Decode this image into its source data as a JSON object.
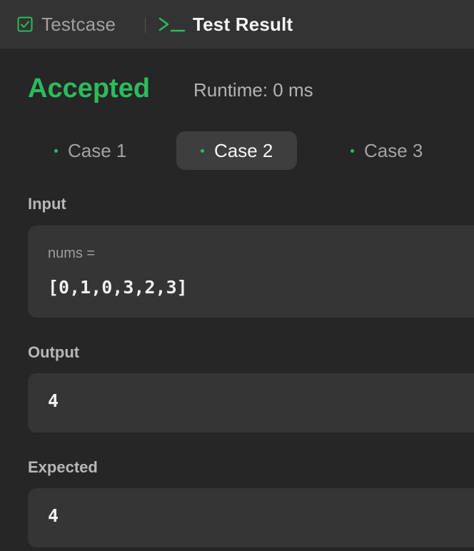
{
  "tabs": {
    "testcase_label": "Testcase",
    "result_label": "Test Result"
  },
  "result": {
    "status": "Accepted",
    "runtime": "Runtime: 0 ms"
  },
  "cases": [
    {
      "label": "Case 1"
    },
    {
      "label": "Case 2"
    },
    {
      "label": "Case 3"
    }
  ],
  "active_case": "Case 2",
  "input": {
    "section_label": "Input",
    "param_name": "nums =",
    "param_value": "[0,1,0,3,2,3]"
  },
  "output": {
    "section_label": "Output",
    "value": "4"
  },
  "expected": {
    "section_label": "Expected",
    "value": "4"
  },
  "colors": {
    "accent_green": "#2cbb5d",
    "background": "#262626",
    "panel": "#353535"
  },
  "icons": {
    "testcase_tab": "checkbox-icon",
    "result_tab": "terminal-icon",
    "case_status": "dot-icon"
  }
}
